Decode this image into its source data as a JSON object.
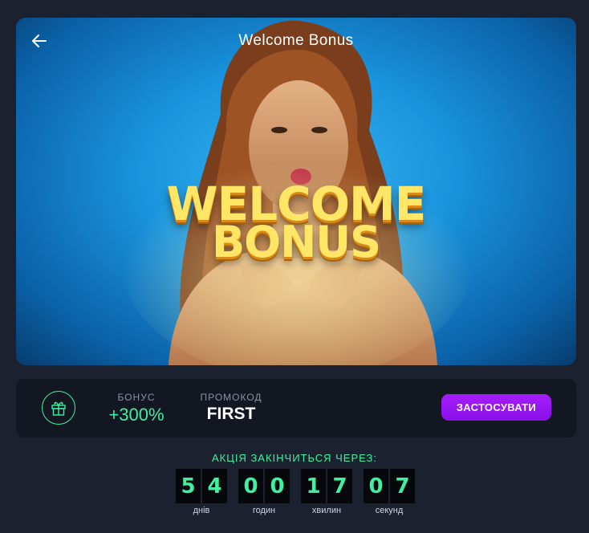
{
  "header": {
    "title": "Welcome Bonus",
    "back_icon": "arrow-left-icon"
  },
  "banner": {
    "overlay_line1": "WELCOME",
    "overlay_line2": "BONUS",
    "background_color": "#1993dd",
    "text_color": "#ffe666"
  },
  "info": {
    "gift_icon": "gift-icon",
    "bonus_label": "БОНУС",
    "bonus_value": "+300%",
    "promo_label": "ПРОМОКОД",
    "promo_value": "FIRST",
    "apply_label": "ЗАСТОСУВАТИ",
    "accent_color": "#3ff0a0",
    "button_color": "#a61dff"
  },
  "countdown": {
    "label": "АКЦІЯ ЗАКІНЧИТЬСЯ ЧЕРЕЗ:",
    "units": [
      {
        "d1": "5",
        "d2": "4",
        "label": "днів"
      },
      {
        "d1": "0",
        "d2": "0",
        "label": "годин"
      },
      {
        "d1": "1",
        "d2": "7",
        "label": "хвилин"
      },
      {
        "d1": "0",
        "d2": "7",
        "label": "секунд"
      }
    ]
  }
}
